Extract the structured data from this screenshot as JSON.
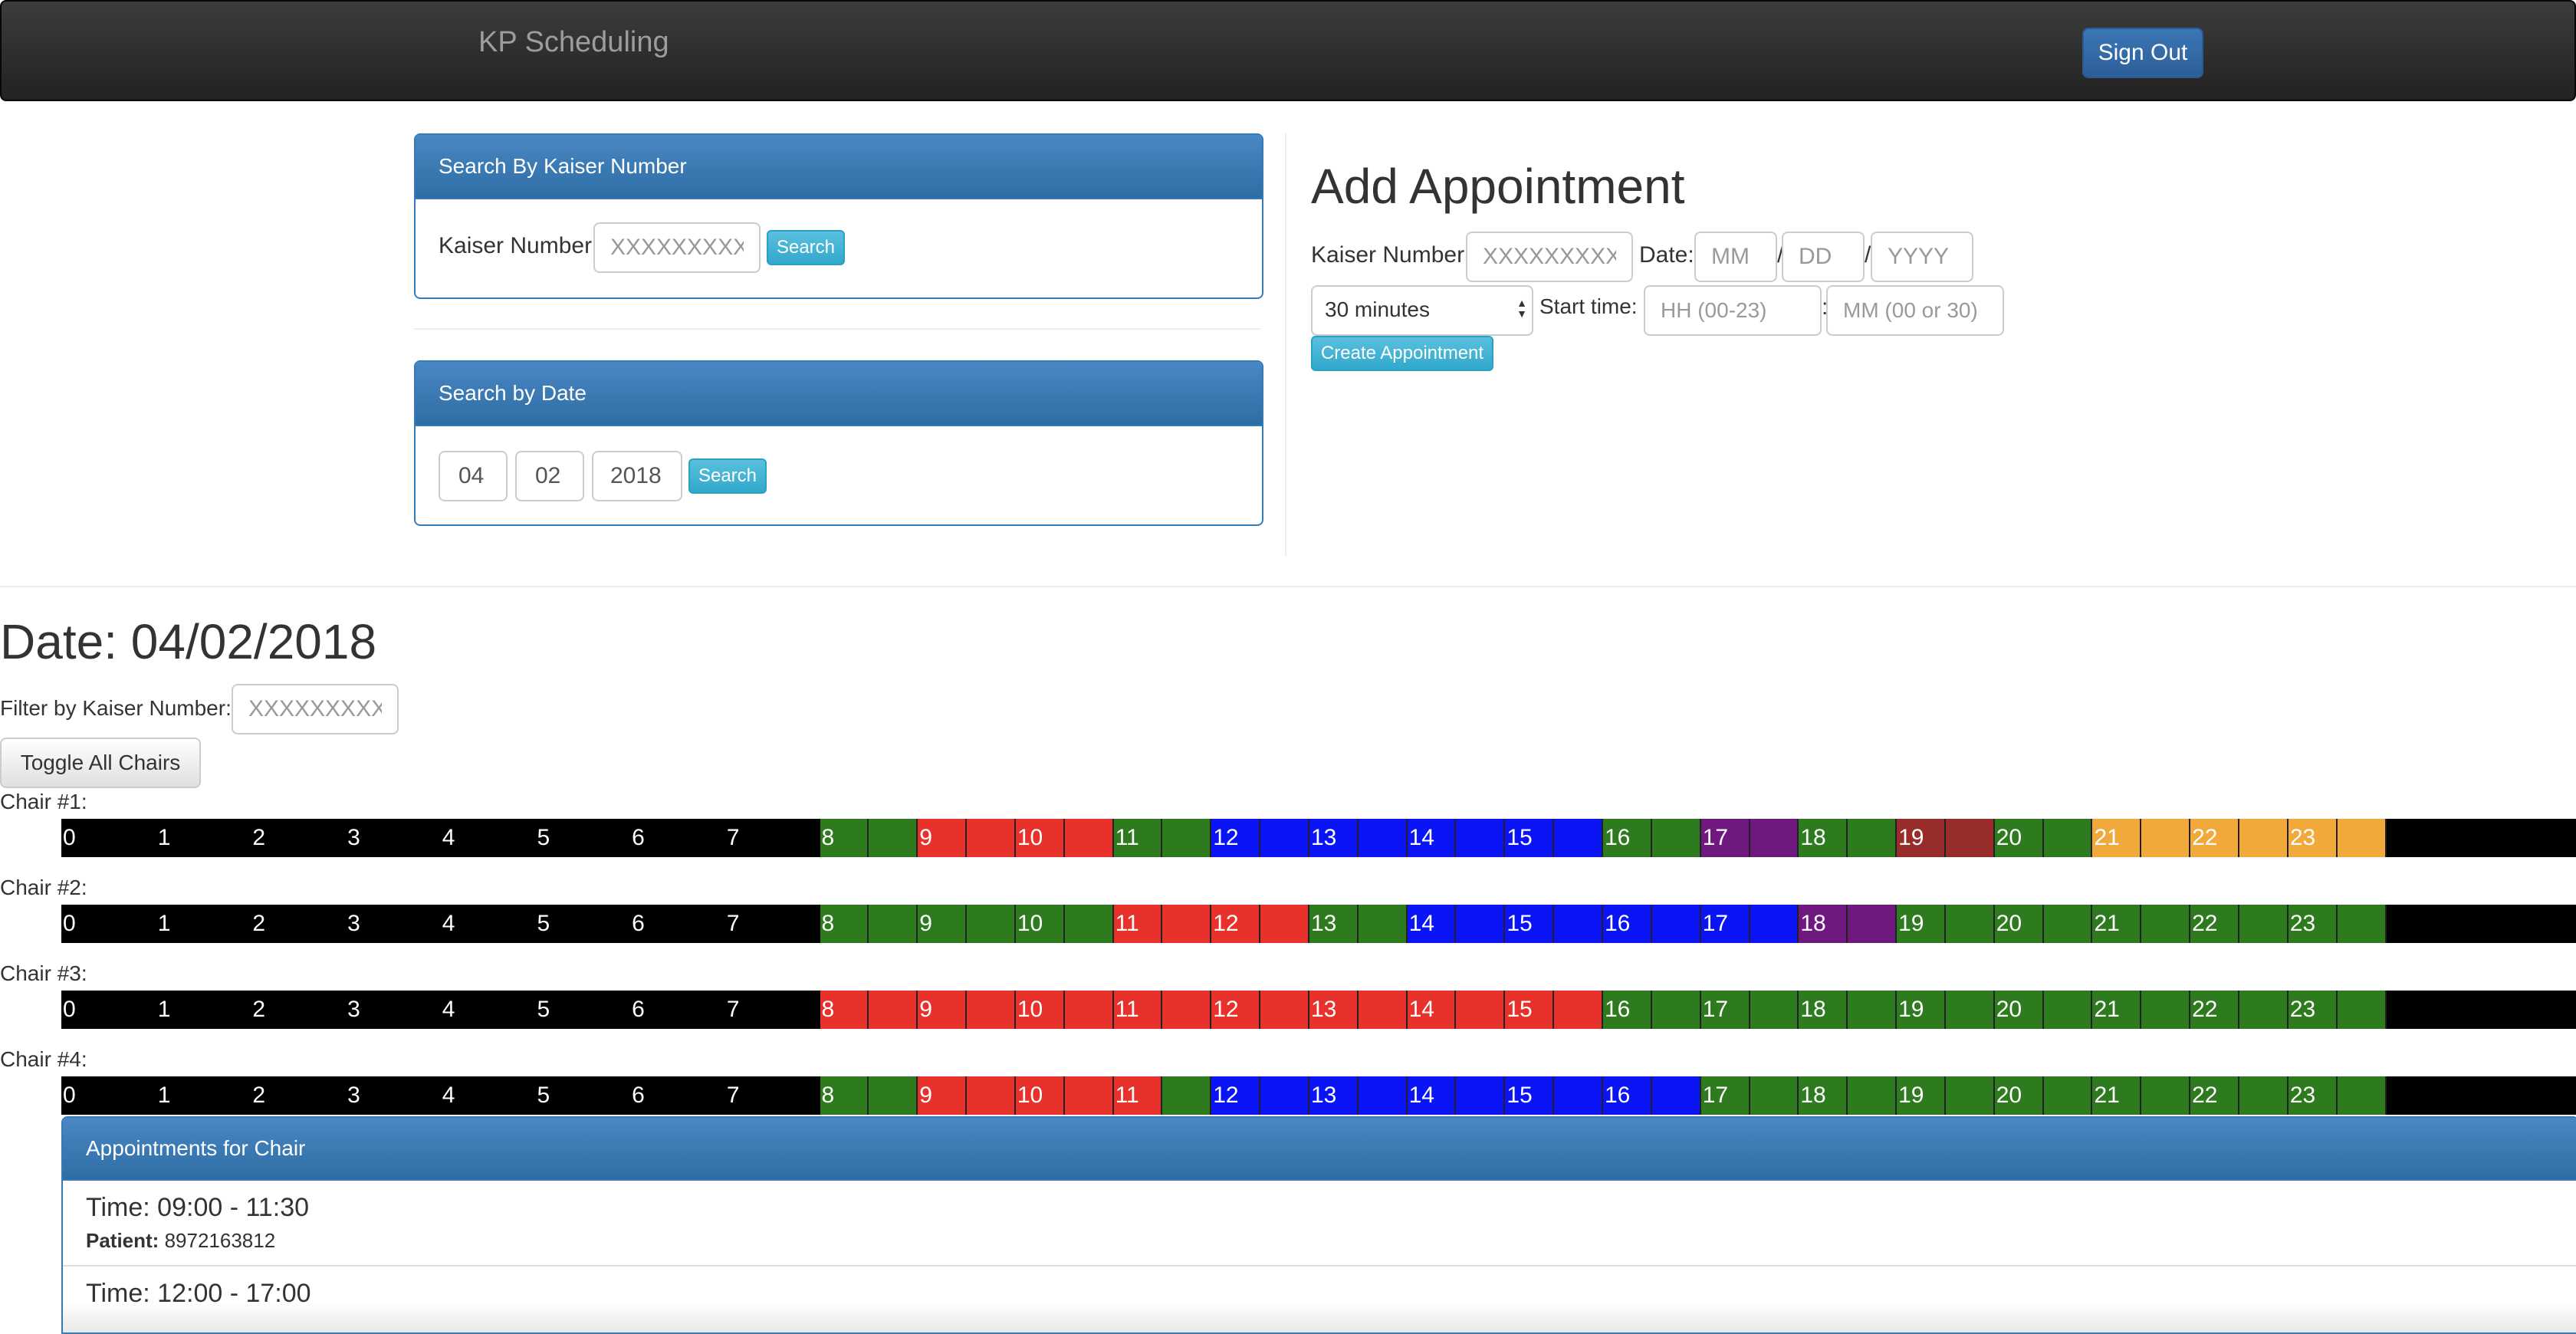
{
  "navbar": {
    "brand": "KP Scheduling",
    "sign_out": "Sign Out"
  },
  "search_kaiser": {
    "heading": "Search By Kaiser Number",
    "label": "Kaiser Number:",
    "placeholder": "XXXXXXXXX",
    "button": "Search"
  },
  "search_date": {
    "heading": "Search by Date",
    "month": "04",
    "day": "02",
    "year": "2018",
    "button": "Search"
  },
  "add_appointment": {
    "title": "Add Appointment",
    "kaiser_label": "Kaiser Number:",
    "kaiser_placeholder": "XXXXXXXXX",
    "date_label": "Date:",
    "mm_placeholder": "MM",
    "dd_placeholder": "DD",
    "yyyy_placeholder": "YYYY",
    "slash": "/",
    "duration": "30 minutes",
    "start_label": "Start time:",
    "hh_placeholder": "HH (00-23)",
    "colon": ":",
    "min_placeholder": "MM (00 or 30)",
    "create_button": "Create Appointment"
  },
  "schedule": {
    "date_title": "Date: 04/02/2018",
    "filter_label": "Filter by Kaiser Number:",
    "filter_placeholder": "XXXXXXXXX",
    "toggle_button": "Toggle All Chairs",
    "colors": {
      "black": "#000000",
      "green": "#2d7a1f",
      "red": "#e8312a",
      "blue": "#0a14f5",
      "purple": "#6e1880",
      "maroon": "#982c2a",
      "orange": "#f2a93b"
    },
    "chairs": [
      {
        "label": "Chair #1:",
        "slots": [
          "black",
          "black",
          "black",
          "black",
          "black",
          "black",
          "black",
          "black",
          "black",
          "black",
          "black",
          "black",
          "black",
          "black",
          "black",
          "black",
          "green",
          "green",
          "red",
          "red",
          "red",
          "red",
          "green",
          "green",
          "blue",
          "blue",
          "blue",
          "blue",
          "blue",
          "blue",
          "blue",
          "blue",
          "green",
          "green",
          "purple",
          "purple",
          "green",
          "green",
          "maroon",
          "maroon",
          "green",
          "green",
          "orange",
          "orange",
          "orange",
          "orange",
          "orange",
          "orange",
          "black",
          "black",
          "black",
          "black"
        ]
      },
      {
        "label": "Chair #2:",
        "slots": [
          "black",
          "black",
          "black",
          "black",
          "black",
          "black",
          "black",
          "black",
          "black",
          "black",
          "black",
          "black",
          "black",
          "black",
          "black",
          "black",
          "green",
          "green",
          "green",
          "green",
          "green",
          "green",
          "red",
          "red",
          "red",
          "red",
          "green",
          "green",
          "blue",
          "blue",
          "blue",
          "blue",
          "blue",
          "blue",
          "blue",
          "blue",
          "purple",
          "purple",
          "green",
          "green",
          "green",
          "green",
          "green",
          "green",
          "green",
          "green",
          "green",
          "green",
          "black",
          "black",
          "black",
          "black"
        ]
      },
      {
        "label": "Chair #3:",
        "slots": [
          "black",
          "black",
          "black",
          "black",
          "black",
          "black",
          "black",
          "black",
          "black",
          "black",
          "black",
          "black",
          "black",
          "black",
          "black",
          "black",
          "red",
          "red",
          "red",
          "red",
          "red",
          "red",
          "red",
          "red",
          "red",
          "red",
          "red",
          "red",
          "red",
          "red",
          "red",
          "red",
          "green",
          "green",
          "green",
          "green",
          "green",
          "green",
          "green",
          "green",
          "green",
          "green",
          "green",
          "green",
          "green",
          "green",
          "green",
          "green",
          "black",
          "black",
          "black",
          "black"
        ]
      },
      {
        "label": "Chair #4:",
        "slots": [
          "black",
          "black",
          "black",
          "black",
          "black",
          "black",
          "black",
          "black",
          "black",
          "black",
          "black",
          "black",
          "black",
          "black",
          "black",
          "black",
          "green",
          "green",
          "red",
          "red",
          "red",
          "red",
          "red",
          "green",
          "blue",
          "blue",
          "blue",
          "blue",
          "blue",
          "blue",
          "blue",
          "blue",
          "blue",
          "blue",
          "green",
          "green",
          "green",
          "green",
          "green",
          "green",
          "green",
          "green",
          "green",
          "green",
          "green",
          "green",
          "green",
          "green",
          "black",
          "black",
          "black",
          "black"
        ]
      }
    ],
    "hours": [
      "0",
      "1",
      "2",
      "3",
      "4",
      "5",
      "6",
      "7",
      "8",
      "9",
      "10",
      "11",
      "12",
      "13",
      "14",
      "15",
      "16",
      "17",
      "18",
      "19",
      "20",
      "21",
      "22",
      "23"
    ]
  },
  "appointments": {
    "heading": "Appointments for Chair",
    "patient_label": "Patient:",
    "items": [
      {
        "time": "Time: 09:00 - 11:30",
        "patient": "8972163812"
      },
      {
        "time": "Time: 12:00 - 17:00",
        "patient": ""
      }
    ]
  }
}
